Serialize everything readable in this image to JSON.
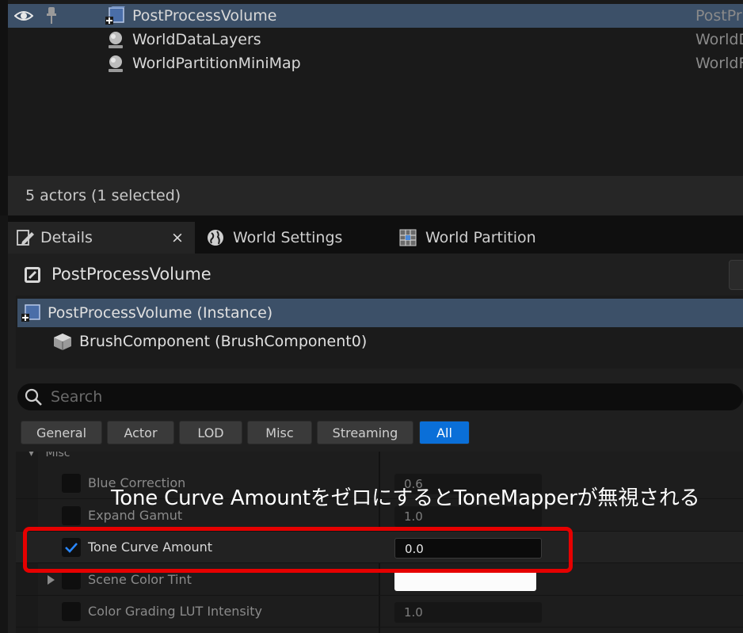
{
  "outliner": {
    "rows": [
      {
        "label": "PostProcessVolume",
        "type": "PostPr",
        "icon": "post-process-volume-icon",
        "selected": true
      },
      {
        "label": "WorldDataLayers",
        "type": "WorldD",
        "icon": "world-info-icon"
      },
      {
        "label": "WorldPartitionMiniMap",
        "type": "WorldF",
        "icon": "world-info-icon"
      }
    ],
    "status": "5 actors (1 selected)"
  },
  "tabs": [
    {
      "label": "Details",
      "icon": "pencil-icon",
      "close": "×",
      "active": true
    },
    {
      "label": "World Settings",
      "icon": "globe-icon"
    },
    {
      "label": "World Partition",
      "icon": "grid-icon"
    }
  ],
  "details": {
    "actor_name": "PostProcessVolume",
    "components": [
      {
        "label": "PostProcessVolume (Instance)",
        "selected": true
      },
      {
        "label": "BrushComponent (BrushComponent0)"
      }
    ],
    "search_placeholder": "Search",
    "filters": [
      "General",
      "Actor",
      "LOD",
      "Misc",
      "Streaming",
      "All"
    ],
    "active_filter": "All",
    "section_header": "Misc",
    "properties": [
      {
        "label": "Blue Correction",
        "value": "0.6",
        "checked": false
      },
      {
        "label": "Expand Gamut",
        "value": "1.0",
        "checked": false
      },
      {
        "label": "Tone Curve Amount",
        "value": "0.0",
        "checked": true
      },
      {
        "label": "Scene Color Tint",
        "value": "",
        "checked": false
      },
      {
        "label": "Color Grading LUT Intensity",
        "value": "1.0",
        "checked": false
      }
    ]
  },
  "annotation": {
    "text": "Tone Curve AmountをゼロにするとToneMapperが無視される",
    "color": "#e60000"
  }
}
